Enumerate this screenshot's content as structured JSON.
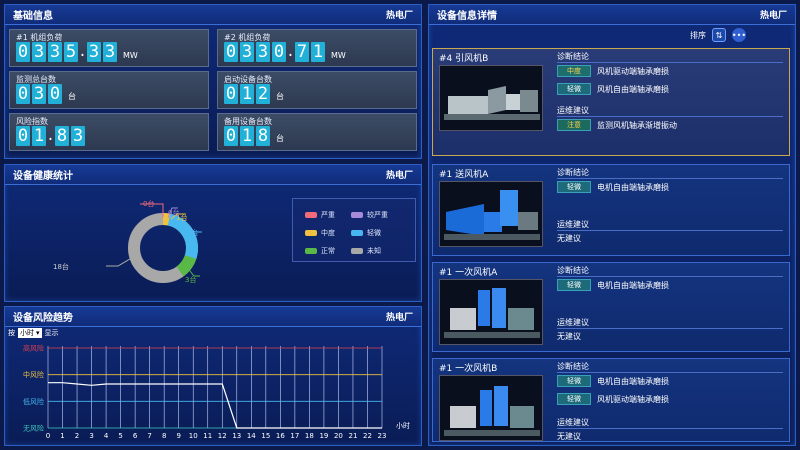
{
  "basic_info": {
    "title": "基础信息",
    "org": "热电厂",
    "cards": [
      {
        "label": "#1 机组负荷",
        "digits": [
          "0",
          "3",
          "3",
          "5",
          ".",
          "3",
          "3"
        ],
        "unit": "MW"
      },
      {
        "label": "#2 机组负荷",
        "digits": [
          "0",
          "3",
          "3",
          "0",
          ".",
          "7",
          "1"
        ],
        "unit": "MW"
      },
      {
        "label": "监测总台数",
        "digits": [
          "0",
          "3",
          "0"
        ],
        "unit": "台"
      },
      {
        "label": "启动设备台数",
        "digits": [
          "0",
          "1",
          "2"
        ],
        "unit": "台"
      },
      {
        "label": "风险指数",
        "digits": [
          "0",
          "1",
          ".",
          "8",
          "3"
        ],
        "unit": ""
      },
      {
        "label": "备用设备台数",
        "digits": [
          "0",
          "1",
          "8"
        ],
        "unit": "台"
      }
    ]
  },
  "health": {
    "title": "设备健康统计",
    "org": "热电厂",
    "labels": {
      "severe": "0台",
      "more_severe": "0台",
      "medium": "1台",
      "light": "8台",
      "normal": "3台",
      "unknown": "18台"
    },
    "legend": [
      {
        "name": "严重",
        "color": "#f06a7a"
      },
      {
        "name": "较严重",
        "color": "#a78ad8"
      },
      {
        "name": "中度",
        "color": "#f0c040"
      },
      {
        "name": "轻微",
        "color": "#48b8f0"
      },
      {
        "name": "正常",
        "color": "#5ab846"
      },
      {
        "name": "未知",
        "color": "#a8a8a8"
      }
    ]
  },
  "chart_data": {
    "type": "line",
    "x": [
      0,
      1,
      2,
      3,
      4,
      5,
      6,
      7,
      8,
      9,
      10,
      11,
      12,
      13,
      14,
      15,
      16,
      17,
      18,
      19,
      20,
      21,
      22,
      23
    ],
    "xlabel": "小时",
    "y_levels": [
      "无风险",
      "低风险",
      "中风险",
      "高风险"
    ],
    "series": [
      {
        "values": [
          1.7,
          1.7,
          1.65,
          1.6,
          1.65,
          1.65,
          1.65,
          1.65,
          1.65,
          1.65,
          1.65,
          1.65,
          1.65,
          0,
          0,
          0,
          0,
          0,
          0,
          0,
          0,
          0,
          0,
          0
        ]
      }
    ],
    "ylim": [
      0,
      3
    ]
  },
  "trend": {
    "title": "设备风险趋势",
    "org": "热电厂",
    "prefix": "按",
    "select_value": "小时",
    "suffix": "显示"
  },
  "details": {
    "title": "设备信息详情",
    "org": "热电厂",
    "sort_label": "排序",
    "sort_icon": "⇅",
    "more_icon": "•••",
    "devices": [
      {
        "name": "#4 引风机B",
        "diag_title": "诊断结论",
        "diagnoses": [
          {
            "level": "中度",
            "text": "风机驱动端轴承磨损"
          },
          {
            "level": "轻微",
            "text": "风机自由端轴承磨损"
          }
        ],
        "advice_title": "运维建议",
        "advice_tag": "注意",
        "advice_text": "监测风机轴承渐增振动"
      },
      {
        "name": "#1 送风机A",
        "diag_title": "诊断结论",
        "diagnoses": [
          {
            "level": "轻微",
            "text": "电机自由端轴承磨损"
          }
        ],
        "advice_title": "运维建议",
        "advice_text": "无建议"
      },
      {
        "name": "#1 一次风机A",
        "diag_title": "诊断结论",
        "diagnoses": [
          {
            "level": "轻微",
            "text": "电机自由端轴承磨损"
          }
        ],
        "advice_title": "运维建议",
        "advice_text": "无建议"
      },
      {
        "name": "#1 一次风机B",
        "diag_title": "诊断结论",
        "diagnoses": [
          {
            "level": "轻微",
            "text": "电机自由端轴承磨损"
          },
          {
            "level": "轻微",
            "text": "风机驱动端轴承磨损"
          }
        ],
        "advice_title": "运维建议",
        "advice_text": "无建议"
      }
    ]
  }
}
